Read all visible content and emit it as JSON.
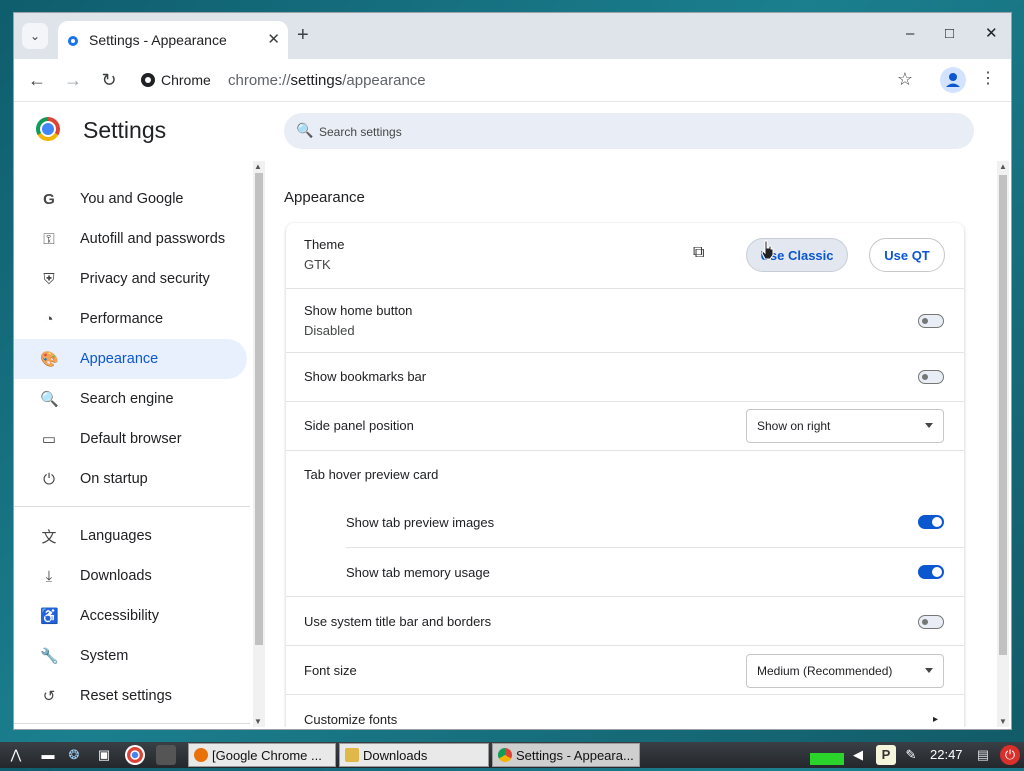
{
  "window": {
    "tab_title": "Settings - Appearance",
    "tab_close_glyph": "✕",
    "newtab_glyph": "+",
    "tab_search_glyph": "⌄",
    "controls": {
      "minimize": "–",
      "maximize": "□",
      "close": "✕"
    }
  },
  "toolbar": {
    "back_glyph": "←",
    "forward_glyph": "→",
    "reload_glyph": "↻",
    "chip_label": "Chrome",
    "url_scheme": "chrome://",
    "url_host": "settings",
    "url_path": "/appearance",
    "star_glyph": "☆",
    "menu_glyph": "⋮"
  },
  "header": {
    "title": "Settings",
    "search_placeholder": "Search settings",
    "search_glyph": "🔍"
  },
  "sidebar": {
    "items": [
      {
        "label": "You and Google",
        "icon": "G",
        "icon_name": "google-icon"
      },
      {
        "label": "Autofill and passwords",
        "icon": "⚿",
        "icon_name": "key-icon"
      },
      {
        "label": "Privacy and security",
        "icon": "⛨",
        "icon_name": "shield-icon"
      },
      {
        "label": "Performance",
        "icon": "◔",
        "icon_name": "speedometer-icon"
      },
      {
        "label": "Appearance",
        "icon": "🎨",
        "icon_name": "palette-icon",
        "active": true
      },
      {
        "label": "Search engine",
        "icon": "🔍",
        "icon_name": "search-icon"
      },
      {
        "label": "Default browser",
        "icon": "▭",
        "icon_name": "browser-icon"
      },
      {
        "label": "On startup",
        "icon": "⏻",
        "icon_name": "power-icon"
      },
      {
        "label": "Languages",
        "icon": "文",
        "icon_name": "translate-icon"
      },
      {
        "label": "Downloads",
        "icon": "⤓",
        "icon_name": "download-icon"
      },
      {
        "label": "Accessibility",
        "icon": "♿",
        "icon_name": "accessibility-icon"
      },
      {
        "label": "System",
        "icon": "🔧",
        "icon_name": "wrench-icon"
      },
      {
        "label": "Reset settings",
        "icon": "↺",
        "icon_name": "reset-icon"
      }
    ]
  },
  "main": {
    "section_title": "Appearance",
    "theme": {
      "label": "Theme",
      "value": "GTK",
      "open_glyph": "⧉",
      "classic_button": "Use Classic",
      "qt_button": "Use QT"
    },
    "home_button": {
      "label": "Show home button",
      "sub": "Disabled",
      "on": false
    },
    "bookmarks_bar": {
      "label": "Show bookmarks bar",
      "on": false
    },
    "side_panel": {
      "label": "Side panel position",
      "value": "Show on right"
    },
    "tab_hover": {
      "label": "Tab hover preview card",
      "preview_images": {
        "label": "Show tab preview images",
        "on": true
      },
      "memory_usage": {
        "label": "Show tab memory usage",
        "on": true
      }
    },
    "system_title_bar": {
      "label": "Use system title bar and borders",
      "on": false
    },
    "font_size": {
      "label": "Font size",
      "value": "Medium (Recommended)"
    },
    "customize_fonts": {
      "label": "Customize fonts",
      "chevron": "▸"
    }
  },
  "taskbar": {
    "tasks": [
      {
        "label": "[Google Chrome ...",
        "icon_color": "#e8710a"
      },
      {
        "label": "Downloads",
        "icon_color": "#e0b84a"
      },
      {
        "label": "Settings - Appeara...",
        "icon_color": "#34a853"
      }
    ],
    "clock": "22:47",
    "tray_p": "P"
  },
  "colors": {
    "accent": "#0b57d0",
    "active_bg": "#e8f0fe",
    "toggle_on": "#0b57d0"
  }
}
